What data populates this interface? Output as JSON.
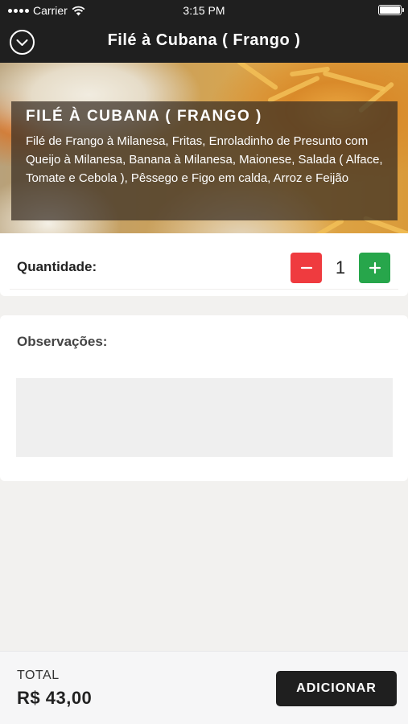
{
  "status_bar": {
    "carrier": "Carrier",
    "time": "3:15 PM",
    "icons": [
      "signal-dots-icon",
      "wifi-icon",
      "battery-icon"
    ]
  },
  "nav": {
    "title": "Filé à Cubana ( Frango )",
    "back_icon": "chevron-down-circle-icon"
  },
  "dish": {
    "title": "FILÉ À CUBANA ( FRANGO )",
    "description": "Filé de Frango à Milanesa, Fritas, Enroladinho de Presunto com Queijo à Milanesa, Banana à Milanesa, Maionese, Salada ( Alface, Tomate e Cebola ), Pêssego e Figo em calda, Arroz e Feijão"
  },
  "quantity": {
    "label": "Quantidade:",
    "value": "1",
    "minus_icon": "minus-icon",
    "plus_icon": "plus-icon"
  },
  "observations": {
    "label": "Observações:",
    "value": "",
    "placeholder": ""
  },
  "footer": {
    "total_label": "TOTAL",
    "total_value": "R$ 43,00",
    "add_label": "ADICIONAR"
  },
  "colors": {
    "header_bg": "#1f1f1f",
    "minus": "#ef3b3f",
    "plus": "#27a64b",
    "page_bg": "#f2f1ef"
  }
}
